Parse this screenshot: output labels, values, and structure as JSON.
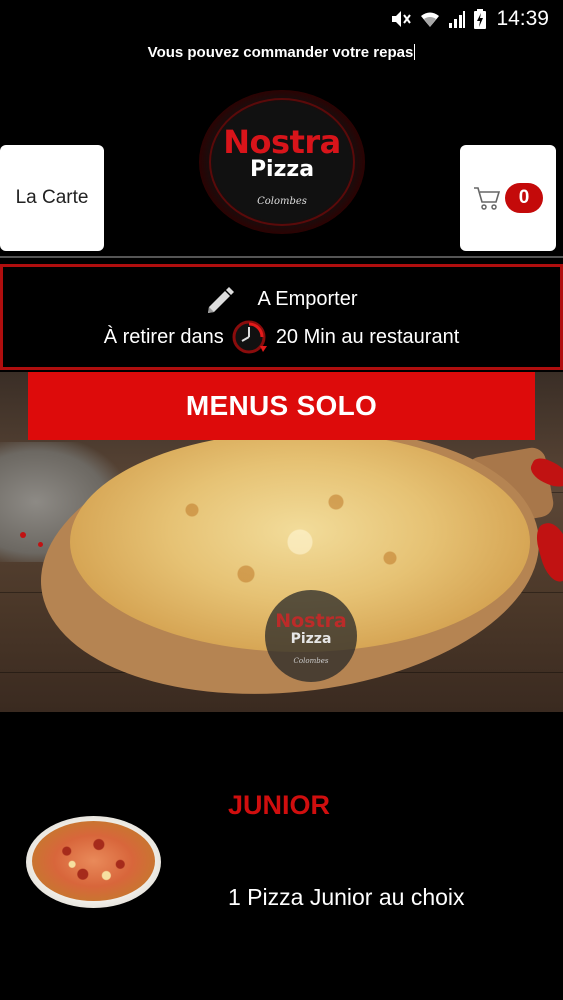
{
  "status_bar": {
    "time": "14:39"
  },
  "marquee": {
    "text": "Vous pouvez commander votre repas"
  },
  "header": {
    "menu_button_label": "La Carte",
    "cart_count": "0",
    "logo": {
      "line1": "Nostra",
      "line2": "Pizza",
      "city": "Colombes"
    }
  },
  "order_info": {
    "mode_label": "A Emporter",
    "pickup_prefix": "À retirer dans",
    "pickup_suffix": "20 Min au restaurant"
  },
  "section": {
    "title": "MENUS SOLO"
  },
  "products": [
    {
      "name": "JUNIOR",
      "description": "1 Pizza Junior au choix"
    }
  ],
  "colors": {
    "accent_red": "#dd0b0b",
    "title_red": "#d00e0e",
    "border_red": "#b00e0e"
  }
}
